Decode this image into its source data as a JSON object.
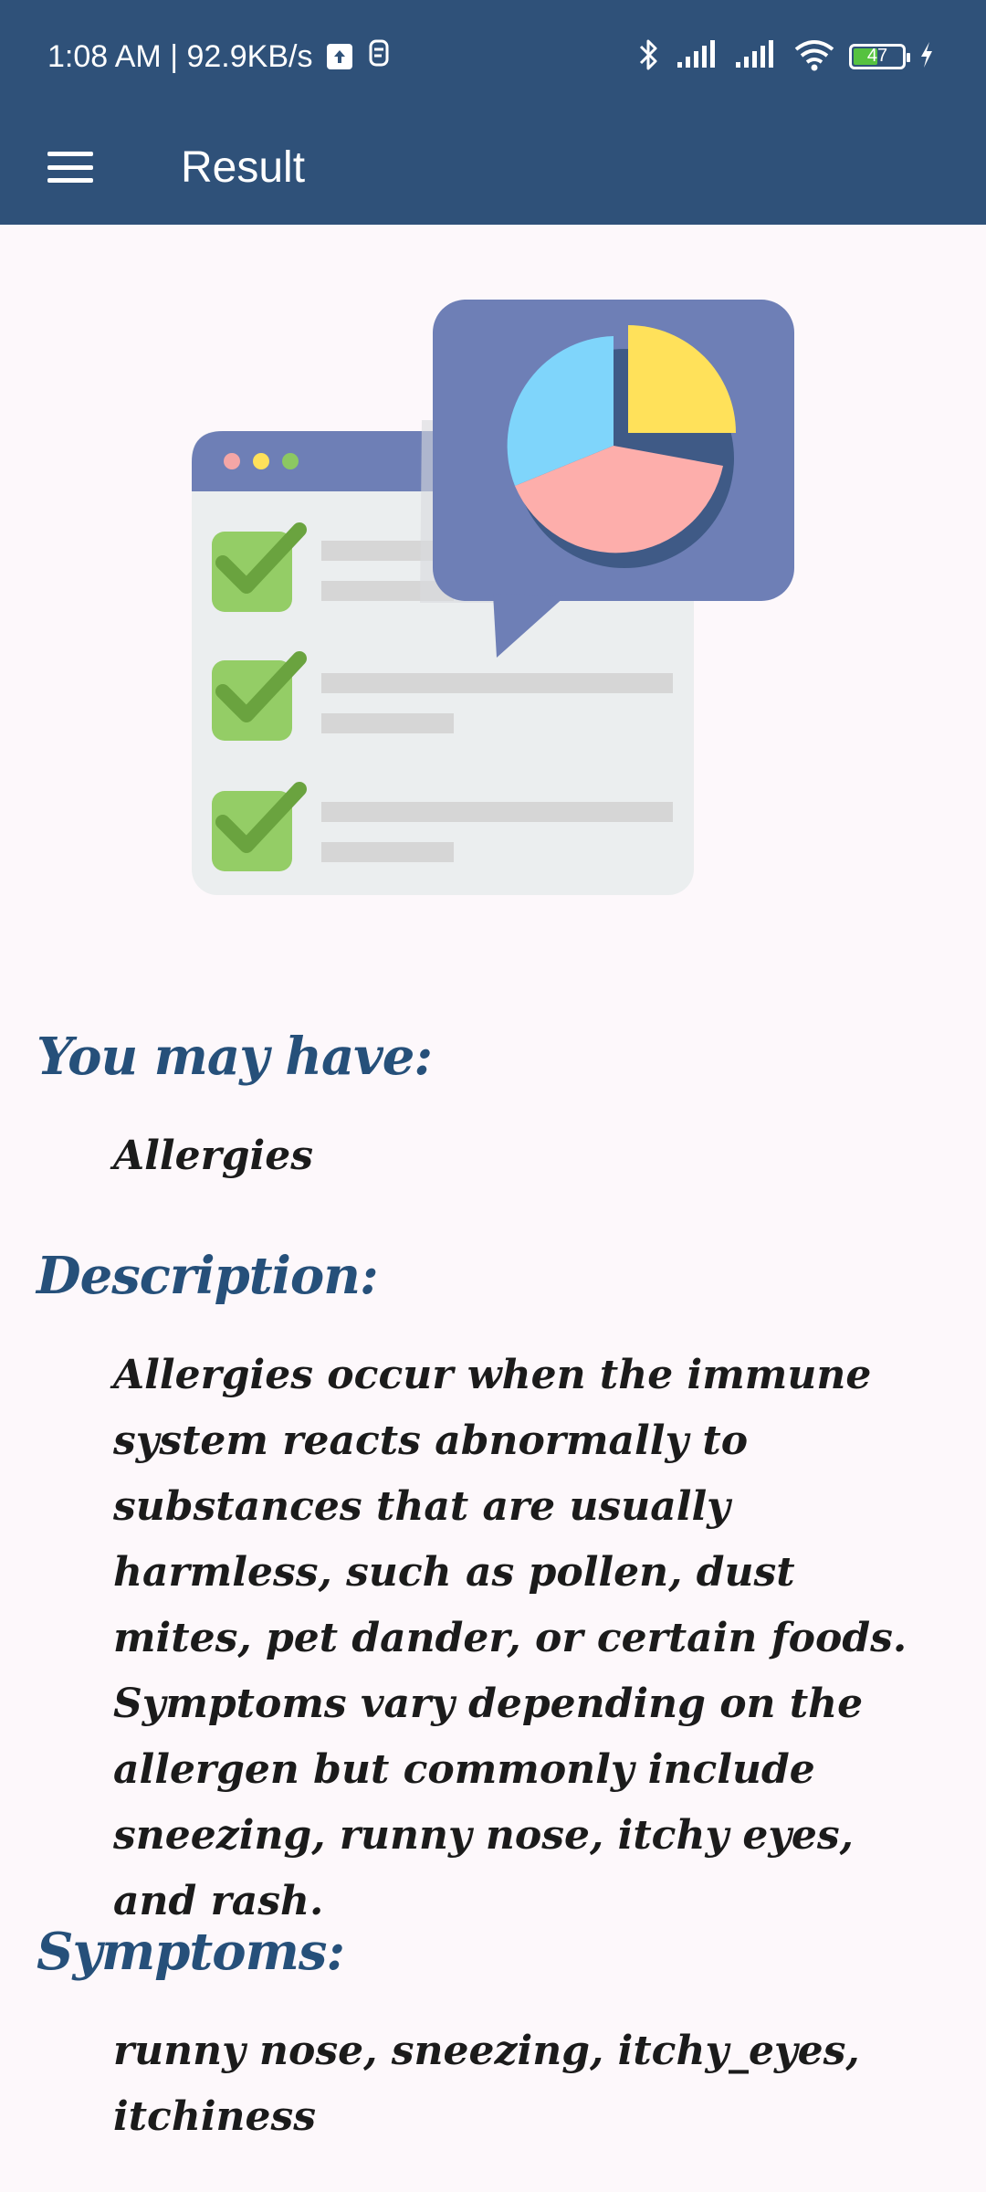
{
  "status_bar": {
    "time_speed": "1:08 AM | 92.9KB/s",
    "battery_level": "47"
  },
  "toolbar": {
    "title": "Result"
  },
  "result": {
    "diagnosis_heading": "You may have:",
    "diagnosis": "Allergies",
    "description_heading": "Description:",
    "description": "Allergies occur when the immune system reacts abnormally to substances that are usually harmless, such as pollen, dust mites, pet dander, or certain foods. Symptoms vary depending on the allergen but commonly include sneezing, runny nose, itchy eyes, and rash.",
    "symptoms_heading": "Symptoms:",
    "symptoms": "runny nose, sneezing, itchy_eyes, itchiness"
  },
  "colors": {
    "app_bar": "#2f5179",
    "heading": "#26507a",
    "background": "#fdf8fb"
  }
}
